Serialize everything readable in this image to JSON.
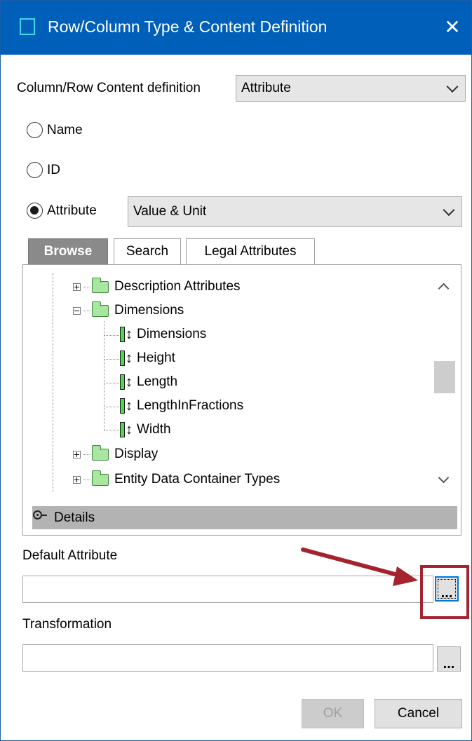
{
  "dialog": {
    "title": "Row/Column Type & Content Definition",
    "close_glyph": "✕"
  },
  "content_definition": {
    "label": "Column/Row Content definition",
    "value": "Attribute"
  },
  "radios": {
    "name": "Name",
    "id": "ID",
    "attribute": "Attribute",
    "selected": "attribute"
  },
  "attribute_type": {
    "value": "Value & Unit"
  },
  "tabs": {
    "browse": "Browse",
    "search": "Search",
    "legal": "Legal Attributes",
    "active": "browse"
  },
  "tree": {
    "description_attributes": "Description Attributes",
    "dimensions_group": "Dimensions",
    "children": [
      "Dimensions",
      "Height",
      "Length",
      "LengthInFractions",
      "Width"
    ],
    "display": "Display",
    "entity_data_container_types": "Entity Data Container Types"
  },
  "details": {
    "label": "Details"
  },
  "default_attribute": {
    "label": "Default Attribute",
    "value": "",
    "button": "..."
  },
  "transformation": {
    "label": "Transformation",
    "value": "",
    "button": "..."
  },
  "buttons": {
    "ok": "OK",
    "cancel": "Cancel"
  },
  "colors": {
    "titlebar": "#005fb8",
    "folder_fill": "#a8e6a1",
    "attribute_bar": "#4fd84a",
    "annotation": "#a3232e"
  }
}
